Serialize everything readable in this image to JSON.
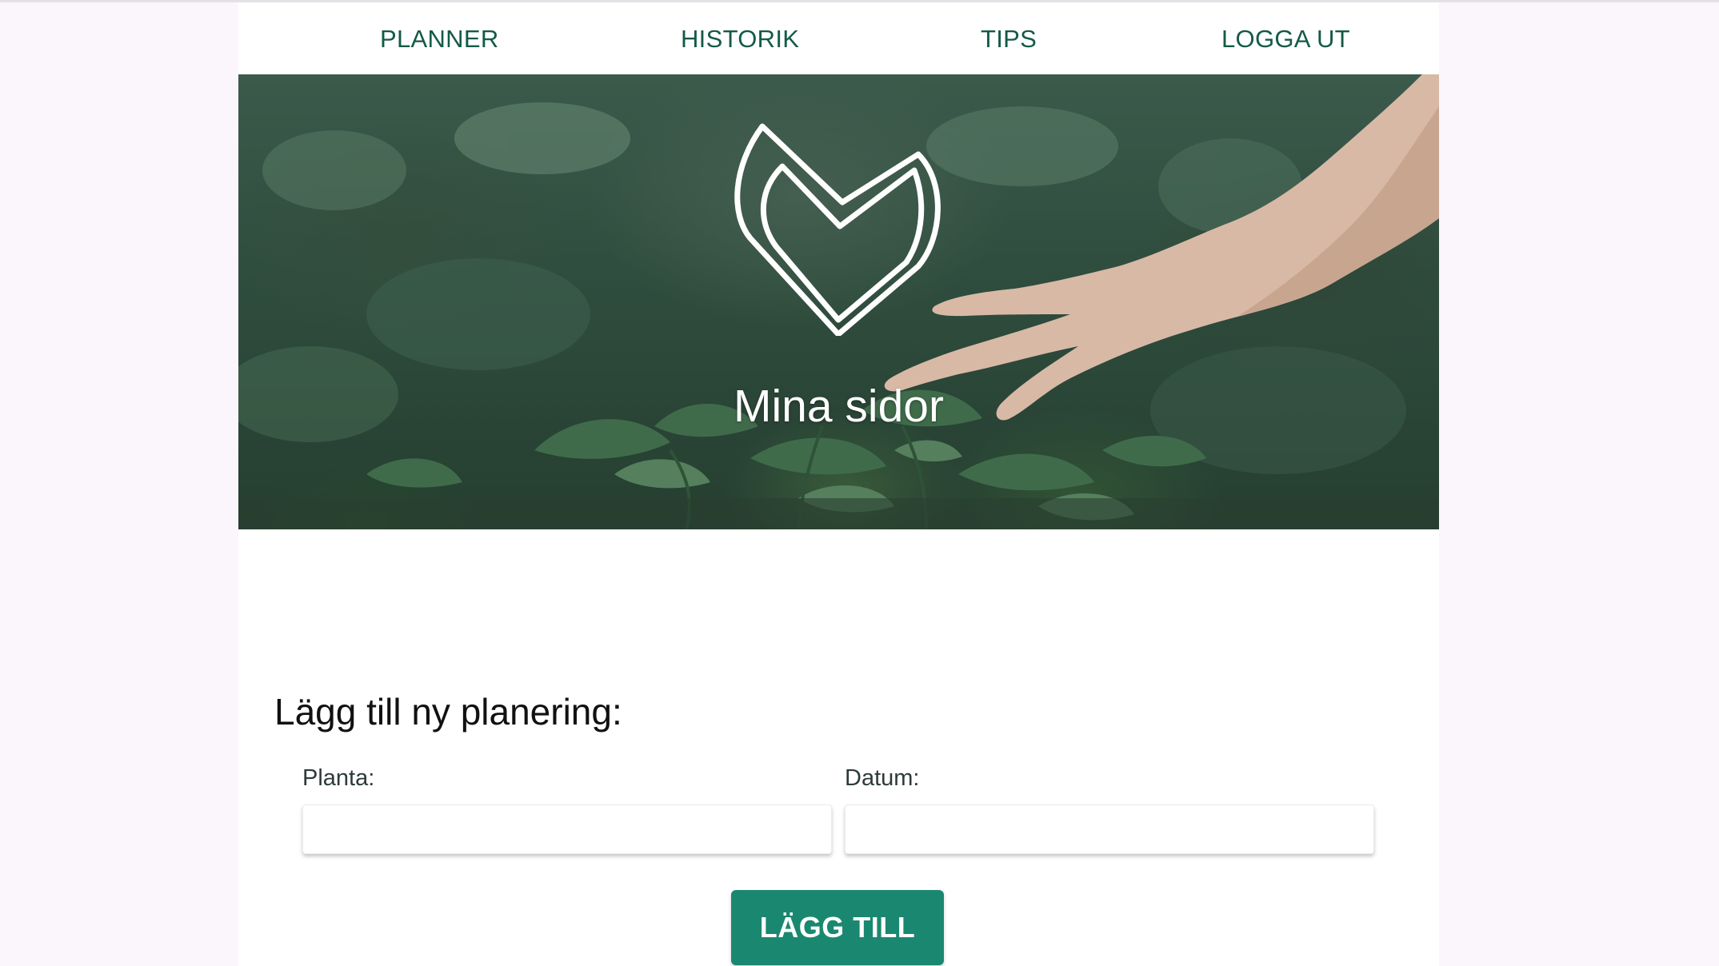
{
  "nav": {
    "items": [
      {
        "label": "PLANNER"
      },
      {
        "label": "HISTORIK"
      },
      {
        "label": "TIPS"
      },
      {
        "label": "LOGGA UT"
      }
    ]
  },
  "hero": {
    "title": "Mina sidor",
    "logo": "heart-leaf-logo"
  },
  "form": {
    "heading": "Lägg till ny planering:",
    "plant_label": "Planta:",
    "plant_value": "",
    "date_label": "Datum:",
    "date_value": "",
    "submit_label": "LÄGG TILL"
  },
  "colors": {
    "accent": "#1a8870",
    "nav_text": "#145a47",
    "page_background": "#fbf6fb"
  }
}
